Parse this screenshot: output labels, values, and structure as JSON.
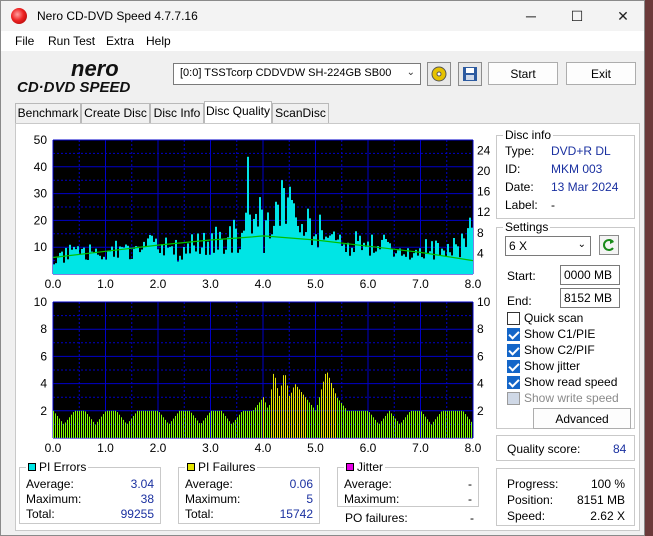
{
  "app": {
    "title": "Nero CD-DVD Speed 4.7.7.16",
    "logo_top": "nero",
    "logo_bottom": "CD·DVD SPEED"
  },
  "window_controls": {
    "minimize": "─",
    "maximize": "☐",
    "close": "✕"
  },
  "menu": [
    "File",
    "Run Test",
    "Extra",
    "Help"
  ],
  "toolbar": {
    "drive": "[0:0]   TSSTcorp CDDVDW SH-224GB SB00",
    "start_label": "Start",
    "exit_label": "Exit",
    "eject_icon": "disc-icon",
    "save_icon": "save-icon"
  },
  "tabs": [
    "Benchmark",
    "Create Disc",
    "Disc Info",
    "Disc Quality",
    "ScanDisc"
  ],
  "active_tab": "Disc Quality",
  "disc_info": {
    "title": "Disc info",
    "type_label": "Type:",
    "type": "DVD+R DL",
    "id_label": "ID:",
    "id": "MKM 003",
    "date_label": "Date:",
    "date": "13 Mar 2024",
    "label_label": "Label:",
    "label": "-"
  },
  "settings": {
    "title": "Settings",
    "speed": "6 X",
    "start_label": "Start:",
    "start": "0000 MB",
    "end_label": "End:",
    "end": "8152 MB",
    "quick_scan": "Quick scan",
    "show_c1": "Show C1/PIE",
    "show_c2": "Show C2/PIF",
    "show_jitter": "Show jitter",
    "show_read": "Show read speed",
    "show_write": "Show write speed",
    "advanced": "Advanced"
  },
  "checkboxes": {
    "quick_scan": false,
    "show_c1": true,
    "show_c2": true,
    "show_jitter": true,
    "show_read": true,
    "show_write": false
  },
  "quality": {
    "label": "Quality score:",
    "value": "84"
  },
  "progress": {
    "progress_label": "Progress:",
    "progress": "100 %",
    "position_label": "Position:",
    "position": "8151 MB",
    "speed_label": "Speed:",
    "speed": "2.62 X"
  },
  "pi_errors": {
    "title": "PI Errors",
    "color": "#00e5e5",
    "average_label": "Average:",
    "average": "3.04",
    "maximum_label": "Maximum:",
    "maximum": "38",
    "total_label": "Total:",
    "total": "99255"
  },
  "pi_failures": {
    "title": "PI Failures",
    "color": "#e5e500",
    "average_label": "Average:",
    "average": "0.06",
    "maximum_label": "Maximum:",
    "maximum": "5",
    "total_label": "Total:",
    "total": "15742"
  },
  "jitter": {
    "title": "Jitter",
    "color": "#e500e5",
    "average_label": "Average:",
    "average": "-",
    "maximum_label": "Maximum:",
    "maximum": "-"
  },
  "po_failures": {
    "label": "PO failures:",
    "value": "-"
  },
  "chart_data": [
    {
      "type": "area",
      "name": "PI Errors chart",
      "x_ticks": [
        "0.0",
        "1.0",
        "2.0",
        "3.0",
        "4.0",
        "5.0",
        "6.0",
        "7.0",
        "8.0"
      ],
      "y_left_ticks": [
        "50",
        "40",
        "30",
        "20",
        "10"
      ],
      "y_right_ticks": [
        "24",
        "20",
        "16",
        "12",
        "8",
        "4"
      ],
      "xlim": [
        0,
        8
      ],
      "ylim": [
        0,
        50
      ],
      "ylim_right": [
        0,
        26
      ],
      "x": [
        0.0,
        0.2,
        0.4,
        0.6,
        0.8,
        1.0,
        1.2,
        1.4,
        1.6,
        1.8,
        2.0,
        2.2,
        2.4,
        2.6,
        2.8,
        3.0,
        3.2,
        3.4,
        3.6,
        3.7,
        3.8,
        3.9,
        4.0,
        4.1,
        4.2,
        4.3,
        4.4,
        4.5,
        4.6,
        4.7,
        4.8,
        4.9,
        5.0,
        5.2,
        5.4,
        5.6,
        5.8,
        6.0,
        6.2,
        6.4,
        6.6,
        6.8,
        7.0,
        7.2,
        7.4,
        7.6,
        7.8,
        8.0
      ],
      "values": [
        8,
        9,
        10,
        8,
        11,
        9,
        12,
        10,
        9,
        13,
        11,
        12,
        10,
        14,
        13,
        15,
        16,
        17,
        18,
        38,
        22,
        34,
        12,
        30,
        24,
        36,
        28,
        32,
        26,
        24,
        22,
        18,
        20,
        16,
        18,
        15,
        14,
        13,
        14,
        12,
        11,
        10,
        12,
        11,
        10,
        12,
        14,
        22
      ],
      "read_speed_x": [
        0.0,
        1.0,
        2.0,
        3.0,
        3.8,
        4.0,
        5.0,
        6.0,
        7.0,
        8.0
      ],
      "read_speed": [
        3.2,
        4.4,
        5.6,
        6.6,
        7.2,
        7.4,
        6.6,
        5.4,
        4.2,
        2.6
      ],
      "colors": {
        "bars": "#00e5e5",
        "speed": "#00c000",
        "background": "#000000",
        "grid": "#0000c8"
      }
    },
    {
      "type": "bar",
      "name": "PI Failures chart",
      "x_ticks": [
        "0.0",
        "1.0",
        "2.0",
        "3.0",
        "4.0",
        "5.0",
        "6.0",
        "7.0",
        "8.0"
      ],
      "y_left_ticks": [
        "10",
        "8",
        "6",
        "4",
        "2"
      ],
      "y_right_ticks": [
        "10",
        "8",
        "6",
        "4",
        "2"
      ],
      "xlim": [
        0,
        8
      ],
      "ylim": [
        0,
        10
      ],
      "x": [
        0.0,
        0.2,
        0.4,
        0.6,
        0.8,
        1.0,
        1.2,
        1.4,
        1.6,
        1.8,
        2.0,
        2.2,
        2.4,
        2.6,
        2.8,
        3.0,
        3.2,
        3.4,
        3.6,
        3.8,
        4.0,
        4.1,
        4.2,
        4.3,
        4.4,
        4.5,
        4.6,
        4.8,
        5.0,
        5.2,
        5.4,
        5.6,
        5.8,
        6.0,
        6.2,
        6.4,
        6.6,
        6.8,
        7.0,
        7.2,
        7.4,
        7.6,
        7.8,
        8.0
      ],
      "values": [
        2,
        1,
        2,
        2,
        1,
        2,
        2,
        1,
        2,
        2,
        2,
        1,
        2,
        2,
        1,
        2,
        2,
        1,
        2,
        2,
        3,
        2,
        5,
        3,
        5,
        3,
        4,
        3,
        2,
        5,
        3,
        2,
        2,
        2,
        1,
        2,
        1,
        2,
        2,
        1,
        2,
        2,
        2,
        1
      ],
      "colors": {
        "bars": "#80ff00",
        "highlight": "#e5e500",
        "background": "#000000",
        "grid": "#0000c8"
      }
    }
  ]
}
